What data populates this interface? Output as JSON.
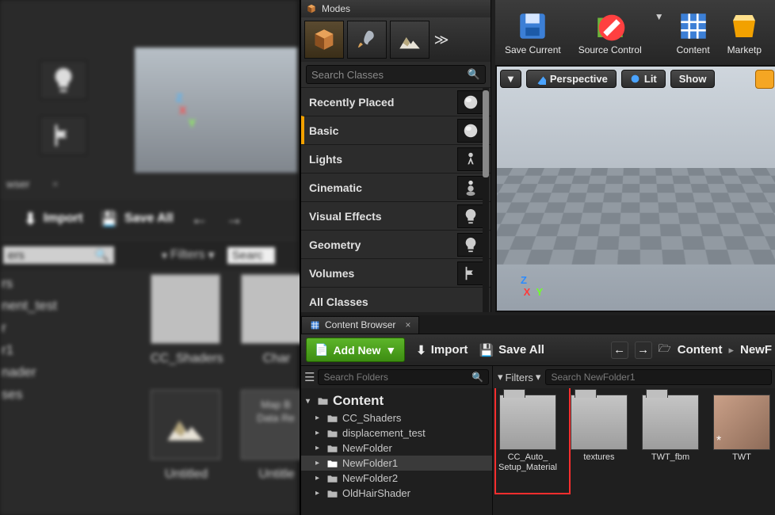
{
  "left": {
    "tab": "wser",
    "import": "Import",
    "saveAll": "Save All",
    "filters": "Filters",
    "searchPlaceholder": "Searc",
    "treeSearchPlaceholder": "ers",
    "tree": [
      "rs",
      "nent_test",
      "r",
      "r1",
      "nader",
      "ses"
    ],
    "assets": [
      {
        "name": "CC_Shaders",
        "kind": "folder"
      },
      {
        "name": "Char",
        "kind": "folder"
      },
      {
        "name": "Untitled",
        "kind": "dark"
      },
      {
        "name": "Untitle",
        "kind": "txt",
        "l1": "Map B",
        "l2": "Data Re"
      }
    ]
  },
  "toolbar": {
    "save": "Save Current",
    "source": "Source Control",
    "content": "Content",
    "market": "Marketp"
  },
  "viewport": {
    "perspective": "Perspective",
    "lit": "Lit",
    "show": "Show"
  },
  "modes": {
    "title": "Modes",
    "searchPlaceholder": "Search Classes",
    "categories": [
      "Recently Placed",
      "Basic",
      "Lights",
      "Cinematic",
      "Visual Effects",
      "Geometry",
      "Volumes",
      "All Classes"
    ],
    "selectedIndex": 1
  },
  "contentBrowser": {
    "tab": "Content Browser",
    "addNew": "Add New",
    "import": "Import",
    "saveAll": "Save All",
    "breadcrumb": [
      "Content",
      "NewF"
    ],
    "searchFolders": "Search Folders",
    "filters": "Filters",
    "searchAssets": "Search NewFolder1",
    "tree": {
      "root": "Content",
      "children": [
        {
          "name": "CC_Shaders"
        },
        {
          "name": "displacement_test"
        },
        {
          "name": "NewFolder"
        },
        {
          "name": "NewFolder1",
          "selected": true
        },
        {
          "name": "NewFolder2"
        },
        {
          "name": "OldHairShader"
        }
      ]
    },
    "assets": [
      {
        "name": "CC_Auto_Setup_Material",
        "kind": "folder",
        "highlight": true
      },
      {
        "name": "textures",
        "kind": "folder"
      },
      {
        "name": "TWT_fbm",
        "kind": "folder"
      },
      {
        "name": "TWT",
        "kind": "img"
      }
    ]
  }
}
